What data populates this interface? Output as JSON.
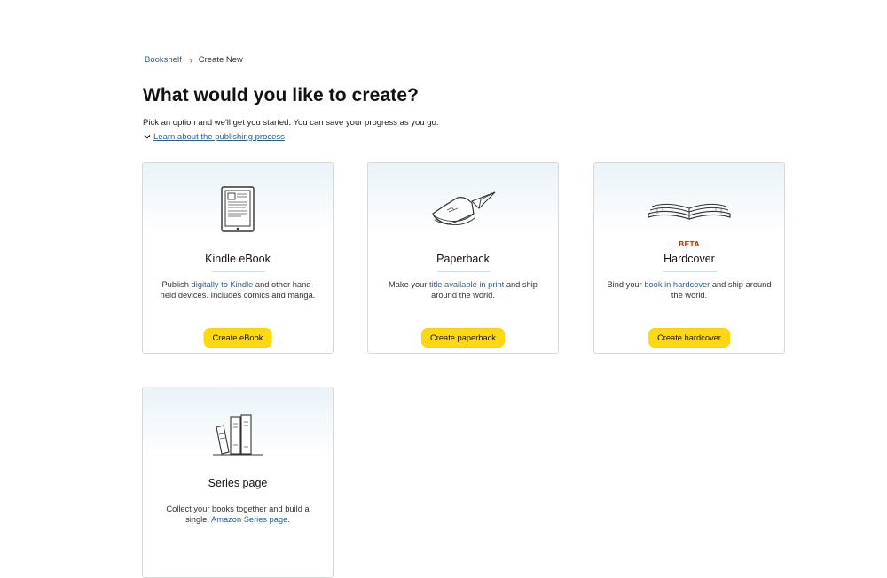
{
  "breadcrumb": {
    "bookshelf": "Bookshelf",
    "current": "Create New"
  },
  "page": {
    "title": "What would you like to create?",
    "intro": "Pick an option and we'll get you started. You can save your progress as you go.",
    "learn_link": "Learn about the publishing process"
  },
  "cards": {
    "ebook": {
      "icon": "ereader-icon",
      "title": "Kindle eBook",
      "desc_pre": "Publish ",
      "desc_link": "digitally to Kindle",
      "desc_post": " and other hand-held devices. Includes comics and manga.",
      "button": "Create eBook"
    },
    "paperback": {
      "icon": "paperback-icon",
      "title": "Paperback",
      "desc_pre": "Make your ",
      "desc_link": "title available in print",
      "desc_post": " and ship around the world.",
      "button": "Create paperback"
    },
    "hardcover": {
      "icon": "open-book-icon",
      "badge": "BETA",
      "title": "Hardcover",
      "desc_pre": "Bind your ",
      "desc_link": "book in hardcover",
      "desc_post": " and ship around the world.",
      "button": "Create hardcover"
    },
    "series": {
      "icon": "book-series-icon",
      "title": "Series page",
      "desc_pre": "Collect your books together and build a single, ",
      "desc_link": "Amazon Series page",
      "desc_post": "."
    }
  },
  "colors": {
    "button": "#ffd814",
    "link": "#2a5f8f",
    "beta": "#b12704",
    "card_gradient_top": "#eaf3f8"
  }
}
